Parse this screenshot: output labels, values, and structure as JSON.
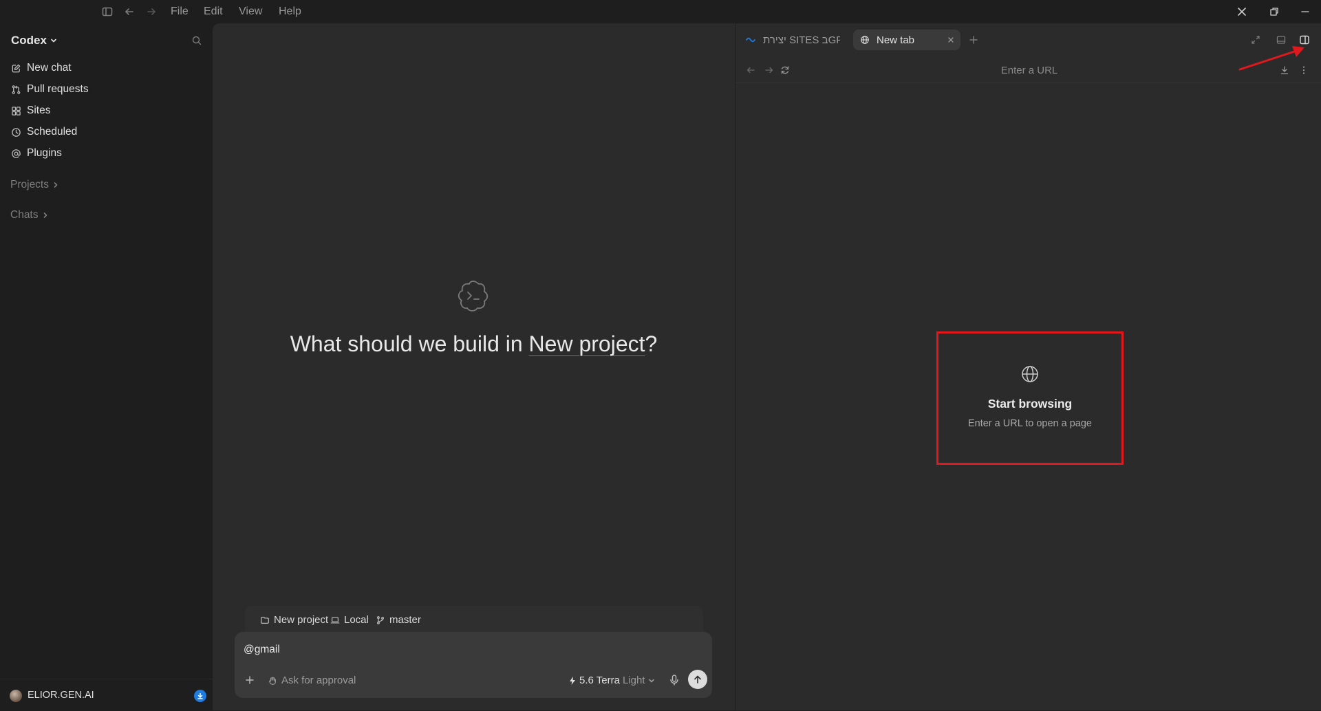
{
  "titlebar": {
    "menu": [
      "File",
      "Edit",
      "View",
      "Help"
    ]
  },
  "sidebar": {
    "brand": "Codex",
    "nav": [
      {
        "label": "New chat",
        "icon": "edit-icon"
      },
      {
        "label": "Pull requests",
        "icon": "pull-request-icon"
      },
      {
        "label": "Sites",
        "icon": "sites-icon"
      },
      {
        "label": "Scheduled",
        "icon": "clock-icon"
      },
      {
        "label": "Plugins",
        "icon": "at-icon"
      }
    ],
    "sections": {
      "projects": "Projects",
      "chats": "Chats"
    },
    "user": "ELIOR.GEN.AI"
  },
  "chat": {
    "headline_prefix": "What should we build in ",
    "headline_link": "New project",
    "headline_suffix": "?",
    "context": {
      "project": "New project",
      "env": "Local",
      "branch": "master"
    },
    "composer": {
      "text": "@gmail",
      "approval": "Ask for approval",
      "model": "5.6 Terra",
      "effort": "Light"
    }
  },
  "browser": {
    "tabs": [
      {
        "label": "יצירת SITES בGP",
        "favicon": "wave-icon"
      },
      {
        "label": "New tab",
        "favicon": "globe-icon"
      }
    ],
    "url_placeholder": "Enter a URL",
    "empty_title": "Start browsing",
    "empty_sub": "Enter a URL to open a page",
    "annotation_color": "#e0191e"
  }
}
